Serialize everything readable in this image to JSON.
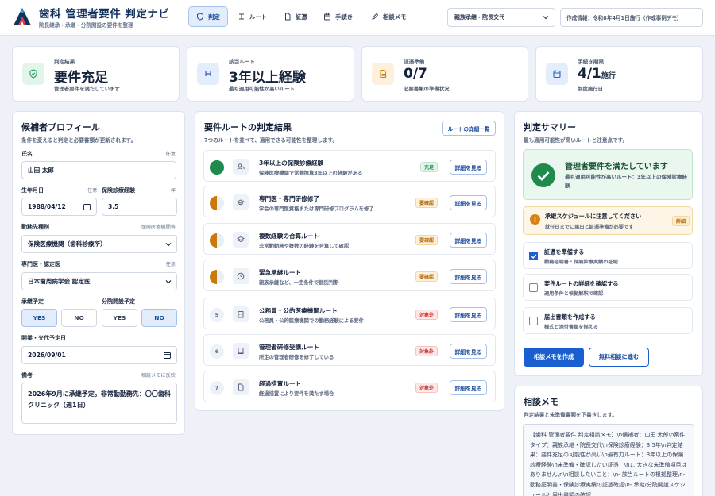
{
  "app": {
    "title": "歯科 管理者要件 判定ナビ",
    "subtitle": "院長継承・承継・分院開設の要件を整理"
  },
  "nav": {
    "tabs": [
      {
        "label": "判定",
        "icon": "shield-icon"
      },
      {
        "label": "ルート",
        "icon": "route-icon"
      },
      {
        "label": "証憑",
        "icon": "document-icon"
      },
      {
        "label": "手続き",
        "icon": "calendar-icon"
      },
      {
        "label": "相談メモ",
        "icon": "pencil-icon"
      }
    ]
  },
  "case_select": {
    "value": "親族承継・院長交代"
  },
  "meta_info": "作成情報：令和8年4月1日施行（作成事例デモ）",
  "kpis": [
    {
      "label": "判定結果",
      "value": "要件充足",
      "unit": "",
      "sub": "管理者要件を満たしています",
      "icon": "shield-check-icon",
      "color": "#1e9a5a",
      "bg": "#e3f5ea"
    },
    {
      "label": "該当ルート",
      "value": "3年以上経験",
      "unit": "",
      "sub": "最も適用可能性が高いルート",
      "icon": "route-icon",
      "color": "#2c63c4",
      "bg": "#e4edfb"
    },
    {
      "label": "証憑準備",
      "value": "0/7",
      "unit": "",
      "sub": "必要書類の準備状況",
      "icon": "document-icon",
      "color": "#d9820f",
      "bg": "#fdf0dc"
    },
    {
      "label": "手続き期限",
      "value": "4/1",
      "unit": "施行",
      "sub": "制度施行日",
      "icon": "calendar-icon",
      "color": "#2c63c4",
      "bg": "#e4edfb"
    }
  ],
  "profile": {
    "title": "候補者プロフィール",
    "subtitle": "条件を変えると判定と必要書類が更新されます。",
    "name_label": "氏名",
    "name_hint": "任意",
    "name_value": "山田 太郎",
    "dob_label": "生年月日",
    "dob_hint": "任意",
    "dob_value": "1988/04/12",
    "years_label": "保険診療経験",
    "years_hint": "年",
    "years_value": "3.5",
    "work_label": "勤務先種別",
    "work_hint": "保険医療機関等",
    "work_value": "保険医療機関（歯科診療所）",
    "spec_label": "専門医・認定医",
    "spec_hint": "任意",
    "spec_value": "日本歯周病学会 認定医",
    "succession_label": "承継予定",
    "succession_yes": "YES",
    "succession_no": "NO",
    "branch_label": "分院開設予定",
    "branch_yes": "YES",
    "branch_no": "NO",
    "date_label": "開業・交代予定日",
    "date_value": "2026/09/01",
    "note_label": "備考",
    "note_hint": "相談メモに反映",
    "note_value": "2026年9月に承継予定。非常勤勤務先：〇〇歯科クリニック（週1日）"
  },
  "routes": {
    "title": "要件ルートの判定結果",
    "subtitle": "7つのルートを並べて、適用できる可能性を整理します。",
    "detail_all": "ルートの詳細一覧",
    "button_label": "詳細を見る",
    "items": [
      {
        "num": "",
        "title": "3年以上の保険診療経験",
        "desc": "保険医療機関で常勤換算3年以上の経験がある",
        "badge": "充足",
        "badge_type": "ok",
        "progress": 1.0,
        "icon": "users-icon"
      },
      {
        "num": "",
        "title": "専門医・専門研修修了",
        "desc": "学会の専門医資格または専門研修プログラムを修了",
        "badge": "要確認",
        "badge_type": "warn",
        "progress": 0.5,
        "icon": "graduation-cap-icon"
      },
      {
        "num": "",
        "title": "複数経験の合算ルート",
        "desc": "非常勤勤務や複数の経験を合算して確認",
        "badge": "要確認",
        "badge_type": "warn",
        "progress": 0.5,
        "icon": "layers-icon"
      },
      {
        "num": "",
        "title": "緊急承継ルート",
        "desc": "親族承継など、一定条件で個別判断",
        "badge": "要確認",
        "badge_type": "warn",
        "progress": 0.5,
        "icon": "clock-icon"
      },
      {
        "num": "5",
        "title": "公務員・公的医療機関ルート",
        "desc": "公務員・公的医療機関での勤務経験による要件",
        "badge": "対象外",
        "badge_type": "na",
        "progress": 0,
        "icon": "building-icon"
      },
      {
        "num": "6",
        "title": "管理者研修受講ルート",
        "desc": "所定の管理者研修を修了している",
        "badge": "対象外",
        "badge_type": "na",
        "progress": 0,
        "icon": "book-icon"
      },
      {
        "num": "7",
        "title": "経過措置ルート",
        "desc": "経過措置により要件を満たす場合",
        "badge": "対象外",
        "badge_type": "na",
        "progress": 0,
        "icon": "document-icon"
      }
    ]
  },
  "summary": {
    "title": "判定サマリー",
    "subtitle": "最も適用可能性が高いルートと注意点です。",
    "result_title": "管理者要件を満たしています",
    "result_desc": "最も適用可能性が高いルート：3年以上の保険診療経験",
    "warn_title": "承継スケジュールに注意してください",
    "warn_desc": "就任日までに届出と証憑準備が必要です",
    "warn_badge": "詳細",
    "checks": [
      {
        "title": "証憑を準備する",
        "desc": "勤務証明書・保険診療実績の証明",
        "checked": true
      },
      {
        "title": "要件ルートの詳細を確認する",
        "desc": "適用条件と根拠解釈で確認",
        "checked": false
      },
      {
        "title": "届出書類を作成する",
        "desc": "様式と添付書類を揃える",
        "checked": false
      }
    ],
    "btn_memo": "相談メモを作成",
    "btn_consult": "無料相談に進む"
  },
  "memo": {
    "title": "相談メモ",
    "subtitle": "判定結果と未準備書類を下書きします。",
    "text": "【歯科 管理者要件 判定相談メモ】\\n候補者：山田 太郎\\n案件タイプ：親族承継・院長交代\\n保険診療経験：3.5年\\n判定結果：要件充足の可能性が高い\\n最有力ルート：3年以上の保険診療経験\\n未準備・確認したい証憑：\\n1. 大きな未準備項目はありません\\n\\n相談したいこと：\\n- 該当ルートの根拠整理\\n- 勤務証明書・保険診療実績の証憑確認\\n- 承継/分院開設スケジュールと届出書類の確認"
  }
}
